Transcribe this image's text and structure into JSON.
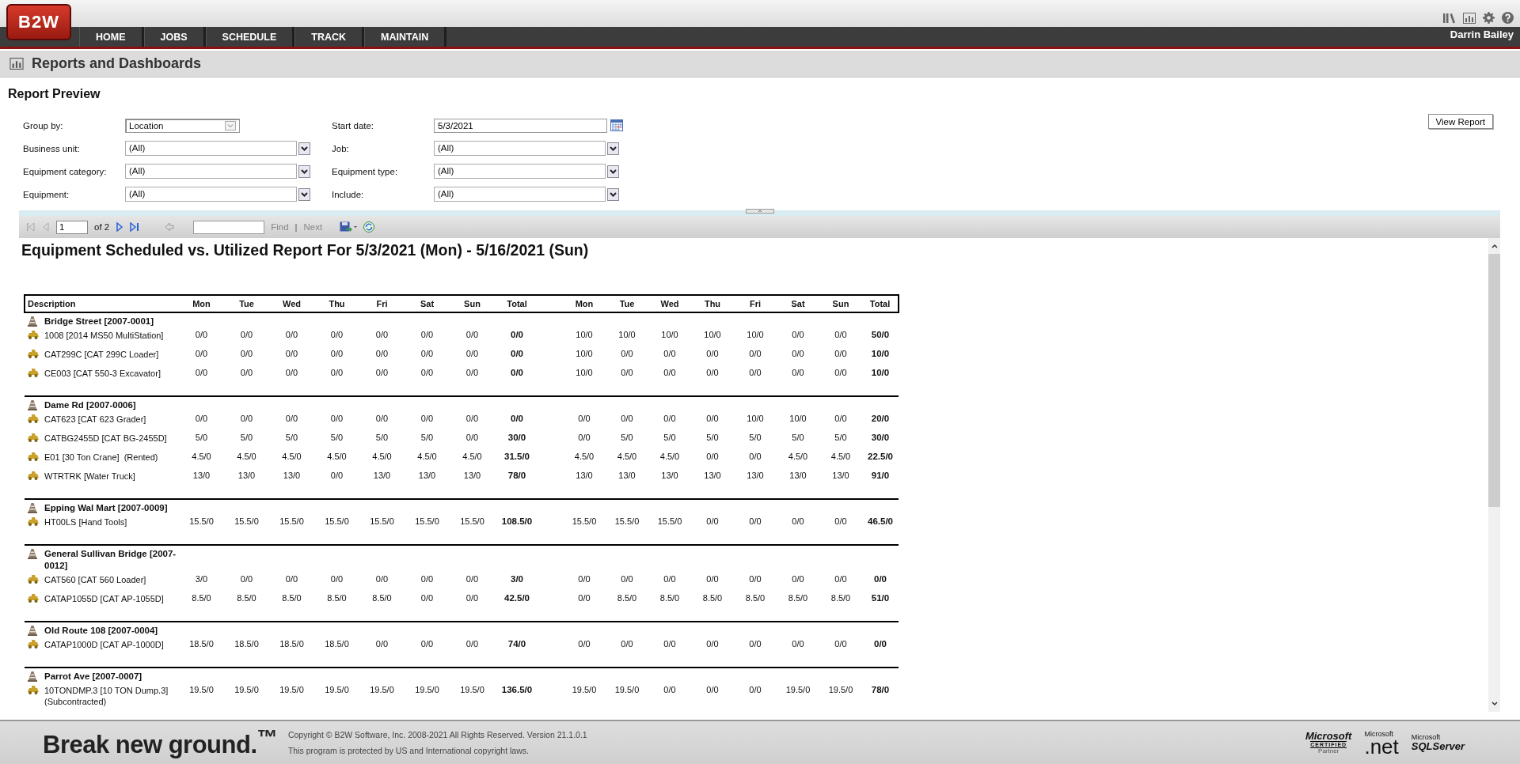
{
  "header": {
    "logo": "B2W",
    "nav": [
      {
        "label": "HOME",
        "selected": false
      },
      {
        "label": "JOBS",
        "selected": false
      },
      {
        "label": "SCHEDULE",
        "selected": false
      },
      {
        "label": "TRACK",
        "selected": false
      },
      {
        "label": "MAINTAIN",
        "selected": false
      }
    ],
    "user": "Darrin Bailey"
  },
  "page_title": "Reports and Dashboards",
  "section_title": "Report Preview",
  "filters": [
    {
      "label": "Group by:",
      "value": "Location",
      "kind": "combo"
    },
    {
      "label": "Start date:",
      "value": "5/3/2021",
      "kind": "date"
    },
    {
      "label": "Business unit:",
      "value": "(All)",
      "kind": "dropdown"
    },
    {
      "label": "Job:",
      "value": "(All)",
      "kind": "dropdown"
    },
    {
      "label": "Equipment category:",
      "value": "(All)",
      "kind": "dropdown"
    },
    {
      "label": "Equipment type:",
      "value": "(All)",
      "kind": "dropdown"
    },
    {
      "label": "Equipment:",
      "value": "(All)",
      "kind": "dropdown"
    },
    {
      "label": "Include:",
      "value": "(All)",
      "kind": "dropdown"
    }
  ],
  "view_button": "View Report",
  "toolbar": {
    "page": "1",
    "page_count": "of 2",
    "find": "Find",
    "separator": "|",
    "next": "Next"
  },
  "report": {
    "title": "Equipment Scheduled vs. Utilized Report For 5/3/2021 (Mon) - 5/16/2021 (Sun)",
    "columns": [
      "Description",
      "Mon",
      "Tue",
      "Wed",
      "Thu",
      "Fri",
      "Sat",
      "Sun",
      "Total",
      "Mon",
      "Tue",
      "Wed",
      "Thu",
      "Fri",
      "Sat",
      "Sun",
      "Total"
    ],
    "groups": [
      {
        "name": "Bridge Street [2007-0001]",
        "items": [
          {
            "description": "1008 [2014 MS50 MultiStation]",
            "cells": [
              "0/0",
              "0/0",
              "0/0",
              "0/0",
              "0/0",
              "0/0",
              "0/0",
              "0/0",
              "10/0",
              "10/0",
              "10/0",
              "10/0",
              "10/0",
              "0/0",
              "0/0",
              "50/0"
            ]
          },
          {
            "description": "CAT299C [CAT 299C Loader]",
            "cells": [
              "0/0",
              "0/0",
              "0/0",
              "0/0",
              "0/0",
              "0/0",
              "0/0",
              "0/0",
              "10/0",
              "0/0",
              "0/0",
              "0/0",
              "0/0",
              "0/0",
              "0/0",
              "10/0"
            ]
          },
          {
            "description": "CE003 [CAT 550-3 Excavator]",
            "cells": [
              "0/0",
              "0/0",
              "0/0",
              "0/0",
              "0/0",
              "0/0",
              "0/0",
              "0/0",
              "10/0",
              "0/0",
              "0/0",
              "0/0",
              "0/0",
              "0/0",
              "0/0",
              "10/0"
            ]
          }
        ]
      },
      {
        "name": "Dame Rd [2007-0006]",
        "items": [
          {
            "description": "CAT623 [CAT 623 Grader]",
            "cells": [
              "0/0",
              "0/0",
              "0/0",
              "0/0",
              "0/0",
              "0/0",
              "0/0",
              "0/0",
              "0/0",
              "0/0",
              "0/0",
              "0/0",
              "10/0",
              "10/0",
              "0/0",
              "20/0"
            ]
          },
          {
            "description": "CATBG2455D [CAT BG-2455D]",
            "cells": [
              "5/0",
              "5/0",
              "5/0",
              "5/0",
              "5/0",
              "5/0",
              "0/0",
              "30/0",
              "0/0",
              "5/0",
              "5/0",
              "5/0",
              "5/0",
              "5/0",
              "5/0",
              "30/0"
            ]
          },
          {
            "description": "E01 [30 Ton Crane]  (Rented)",
            "cells": [
              "4.5/0",
              "4.5/0",
              "4.5/0",
              "4.5/0",
              "4.5/0",
              "4.5/0",
              "4.5/0",
              "31.5/0",
              "4.5/0",
              "4.5/0",
              "4.5/0",
              "0/0",
              "0/0",
              "4.5/0",
              "4.5/0",
              "22.5/0"
            ]
          },
          {
            "description": "WTRTRK [Water Truck]",
            "cells": [
              "13/0",
              "13/0",
              "13/0",
              "0/0",
              "13/0",
              "13/0",
              "13/0",
              "78/0",
              "13/0",
              "13/0",
              "13/0",
              "13/0",
              "13/0",
              "13/0",
              "13/0",
              "91/0"
            ]
          }
        ]
      },
      {
        "name": "Epping Wal Mart [2007-0009]",
        "items": [
          {
            "description": "HT00LS [Hand Tools]",
            "cells": [
              "15.5/0",
              "15.5/0",
              "15.5/0",
              "15.5/0",
              "15.5/0",
              "15.5/0",
              "15.5/0",
              "108.5/0",
              "15.5/0",
              "15.5/0",
              "15.5/0",
              "0/0",
              "0/0",
              "0/0",
              "0/0",
              "46.5/0"
            ]
          }
        ]
      },
      {
        "name": "General Sullivan Bridge [2007-0012]",
        "items": [
          {
            "description": "CAT560 [CAT 560 Loader]",
            "cells": [
              "3/0",
              "0/0",
              "0/0",
              "0/0",
              "0/0",
              "0/0",
              "0/0",
              "3/0",
              "0/0",
              "0/0",
              "0/0",
              "0/0",
              "0/0",
              "0/0",
              "0/0",
              "0/0"
            ]
          },
          {
            "description": "CATAP1055D [CAT AP-1055D]",
            "cells": [
              "8.5/0",
              "8.5/0",
              "8.5/0",
              "8.5/0",
              "8.5/0",
              "0/0",
              "0/0",
              "42.5/0",
              "0/0",
              "8.5/0",
              "8.5/0",
              "8.5/0",
              "8.5/0",
              "8.5/0",
              "8.5/0",
              "51/0"
            ]
          }
        ]
      },
      {
        "name": "Old Route 108 [2007-0004]",
        "items": [
          {
            "description": "CATAP1000D [CAT AP-1000D]",
            "cells": [
              "18.5/0",
              "18.5/0",
              "18.5/0",
              "18.5/0",
              "0/0",
              "0/0",
              "0/0",
              "74/0",
              "0/0",
              "0/0",
              "0/0",
              "0/0",
              "0/0",
              "0/0",
              "0/0",
              "0/0"
            ]
          }
        ]
      },
      {
        "name": "Parrot Ave [2007-0007]",
        "items": [
          {
            "description": "10TONDMP.3 [10 TON Dump.3] (Subcontracted)",
            "cells": [
              "19.5/0",
              "19.5/0",
              "19.5/0",
              "19.5/0",
              "19.5/0",
              "19.5/0",
              "19.5/0",
              "136.5/0",
              "19.5/0",
              "19.5/0",
              "0/0",
              "0/0",
              "0/0",
              "19.5/0",
              "19.5/0",
              "78/0"
            ]
          }
        ]
      }
    ]
  },
  "footer": {
    "tagline": "Break new ground.$^{™}$",
    "copyright": "Copyright © B2W Software, Inc. 2008-2021 All Rights Reserved. Version 21.1.0.1",
    "notice": "This program is protected by US and International copyright laws.",
    "certified": [
      "Microsoft",
      "CERTIFIED",
      "Partner"
    ],
    "dotnet": [
      "Microsoft",
      ".net"
    ],
    "sql": [
      "Microsoft",
      "SQLServer"
    ]
  }
}
